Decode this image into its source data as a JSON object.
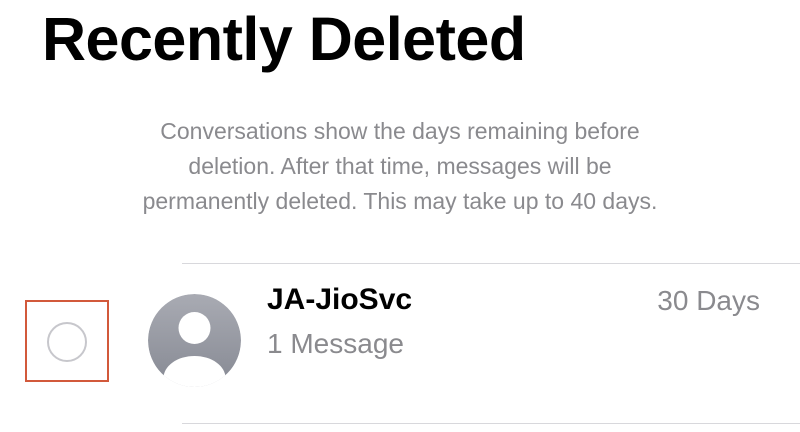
{
  "header": {
    "title": "Recently Deleted"
  },
  "description": {
    "lines": [
      "Conversations show the days remaining before",
      "deletion. After that time, messages will be",
      "permanently deleted. This may take up to 40 days."
    ]
  },
  "conversations": [
    {
      "name": "JA-JioSvc",
      "message_count": "1 Message",
      "days_remaining": "30 Days",
      "selected": false,
      "avatar_icon": "person-placeholder-icon"
    }
  ],
  "colors": {
    "secondary_text": "#8a8a8e",
    "selection_highlight": "#d2593b",
    "radio_border": "#c7c7cc",
    "avatar_gradient_top": "#a9abb3",
    "avatar_gradient_bottom": "#868993"
  }
}
